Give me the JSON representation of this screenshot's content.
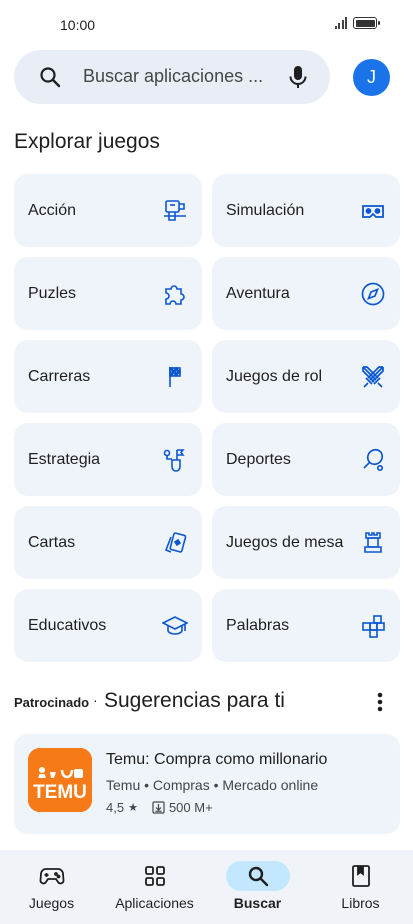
{
  "status_bar": {
    "time": "10:00"
  },
  "search": {
    "placeholder": "Buscar aplicaciones ...",
    "avatar_initial": "J"
  },
  "explore": {
    "title": "Explorar juegos",
    "categories": [
      {
        "label": "Acción",
        "icon": "action-icon"
      },
      {
        "label": "Simulación",
        "icon": "vr-headset-icon"
      },
      {
        "label": "Puzles",
        "icon": "puzzle-icon"
      },
      {
        "label": "Aventura",
        "icon": "compass-icon"
      },
      {
        "label": "Carreras",
        "icon": "checkered-flag-icon"
      },
      {
        "label": "Juegos de rol",
        "icon": "crossed-swords-icon"
      },
      {
        "label": "Estrategia",
        "icon": "strategy-icon"
      },
      {
        "label": "Deportes",
        "icon": "racket-icon"
      },
      {
        "label": "Cartas",
        "icon": "cards-icon"
      },
      {
        "label": "Juegos de mesa",
        "icon": "chess-rook-icon"
      },
      {
        "label": "Educativos",
        "icon": "graduation-cap-icon"
      },
      {
        "label": "Palabras",
        "icon": "word-blocks-icon"
      }
    ]
  },
  "suggestions": {
    "sponsored_label": "Patrocinado",
    "separator": "·",
    "title": "Sugerencias para ti",
    "app": {
      "name": "Temu: Compra como millonario",
      "developer": "Temu",
      "category": "Compras",
      "tag": "Mercado online",
      "rating": "4,5",
      "downloads": "500 M+",
      "logo_text": "TEMU"
    }
  },
  "bottom_nav": [
    {
      "label": "Juegos",
      "icon": "gamepad-icon",
      "active": false
    },
    {
      "label": "Aplicaciones",
      "icon": "apps-grid-icon",
      "active": false
    },
    {
      "label": "Buscar",
      "icon": "search-icon",
      "active": true
    },
    {
      "label": "Libros",
      "icon": "book-icon",
      "active": false
    }
  ],
  "colors": {
    "accent": "#0b57d0",
    "card_bg": "#eff3fa",
    "search_bg": "#e9eef6",
    "nav_active": "#c2e7ff",
    "avatar": "#1a73e8",
    "temu_orange": "#f67b18"
  }
}
